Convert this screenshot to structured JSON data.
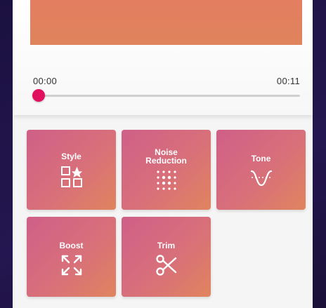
{
  "player": {
    "time_start": "00:00",
    "time_end": "00:11",
    "progress": 0
  },
  "tools": [
    {
      "label": "Style",
      "icon": "shapes-star-icon"
    },
    {
      "label": "Noise\nReduction",
      "icon": "dots-grid-icon"
    },
    {
      "label": "Tone",
      "icon": "curve-icon"
    },
    {
      "label": "Boost",
      "icon": "expand-arrows-icon"
    },
    {
      "label": "Trim",
      "icon": "scissors-icon"
    }
  ],
  "colors": {
    "accent": "#e0115f",
    "tile_start": "#cf5f88",
    "tile_end": "#e0845e",
    "artwork": "#e07e60"
  }
}
